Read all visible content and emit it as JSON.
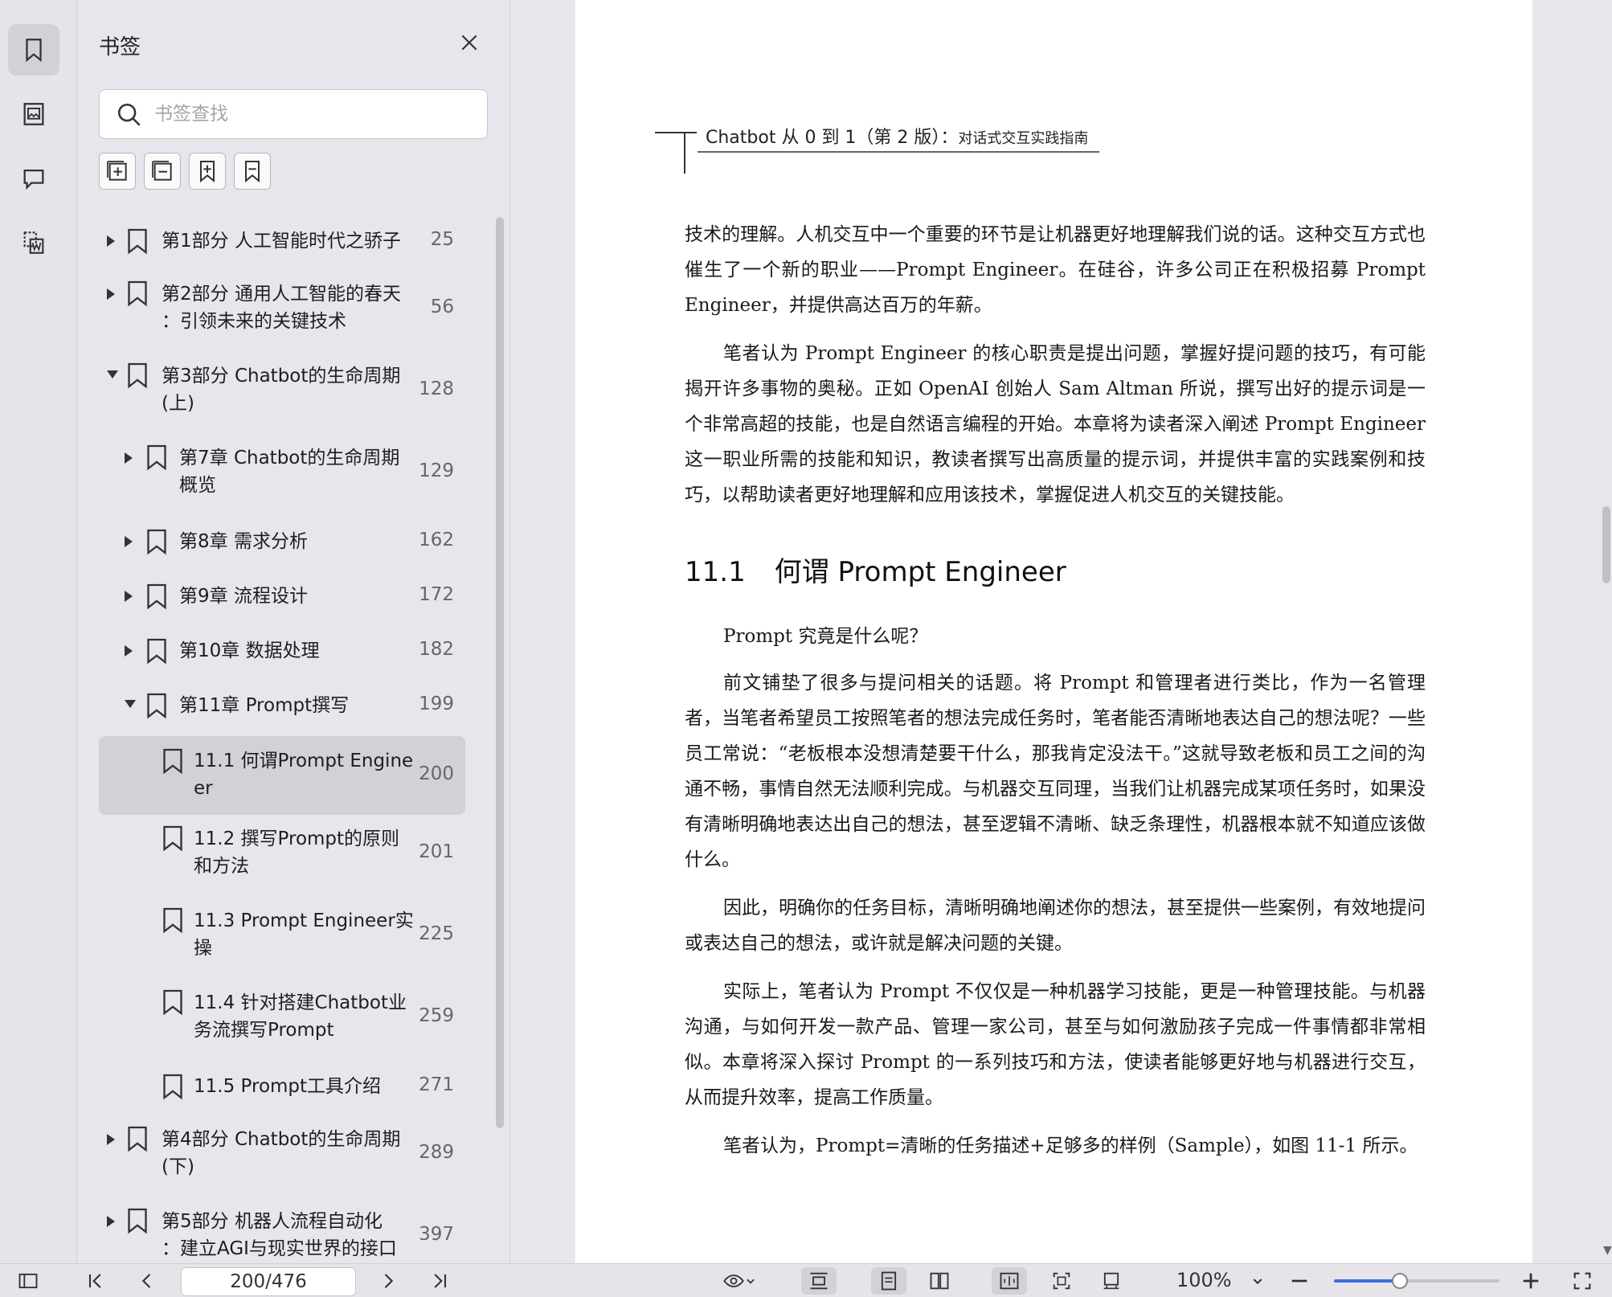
{
  "panel": {
    "title": "书签",
    "search_placeholder": "书签查找"
  },
  "tree": [
    {
      "label": "第1部分 人工智能时代之骄子",
      "page": "25",
      "level": 0,
      "expanded": false
    },
    {
      "label": "第2部分 通用人工智能的春天\n：引领未来的关键技术",
      "page": "56",
      "level": 0,
      "expanded": false
    },
    {
      "label": "第3部分 Chatbot的生命周期\n(上)",
      "page": "128",
      "level": 0,
      "expanded": true
    },
    {
      "label": "第7章 Chatbot的生命周期\n概览",
      "page": "129",
      "level": 1,
      "expanded": false
    },
    {
      "label": "第8章 需求分析",
      "page": "162",
      "level": 1,
      "expanded": false
    },
    {
      "label": "第9章 流程设计",
      "page": "172",
      "level": 1,
      "expanded": false
    },
    {
      "label": "第10章 数据处理",
      "page": "182",
      "level": 1,
      "expanded": false
    },
    {
      "label": "第11章 Prompt撰写",
      "page": "199",
      "level": 1,
      "expanded": true
    },
    {
      "label": "11.1 何谓Prompt Engine\ner",
      "page": "200",
      "level": 2,
      "selected": true
    },
    {
      "label": "11.2 撰写Prompt的原则\n和方法",
      "page": "201",
      "level": 2
    },
    {
      "label": "11.3 Prompt Engineer实\n操",
      "page": "225",
      "level": 2
    },
    {
      "label": "11.4 针对搭建Chatbot业\n务流撰写Prompt",
      "page": "259",
      "level": 2
    },
    {
      "label": "11.5 Prompt工具介绍",
      "page": "271",
      "level": 2
    },
    {
      "label": "第4部分 Chatbot的生命周期\n(下)",
      "page": "289",
      "level": 0,
      "expanded": false
    },
    {
      "label": "第5部分 机器人流程自动化\n：建立AGI与现实世界的接口",
      "page": "397",
      "level": 0,
      "expanded": false
    }
  ],
  "document": {
    "running_head_main": "Chatbot 从 0 到 1（第 2 版）：",
    "running_head_sub": "对话式交互实践指南",
    "p1": "技术的理解。人机交互中一个重要的环节是让机器更好地理解我们说的话。这种交互方式也催生了一个新的职业——Prompt Engineer。在硅谷，许多公司正在积极招募 Prompt Engineer，并提供高达百万的年薪。",
    "p2": "笔者认为 Prompt Engineer 的核心职责是提出问题，掌握好提问题的技巧，有可能揭开许多事物的奥秘。正如 OpenAI 创始人 Sam Altman 所说，撰写出好的提示词是一个非常高超的技能，也是自然语言编程的开始。本章将为读者深入阐述 Prompt Engineer 这一职业所需的技能和知识，教读者撰写出高质量的提示词，并提供丰富的实践案例和技巧，以帮助读者更好地理解和应用该技术，掌握促进人机交互的关键技能。",
    "section_num": "11.1",
    "section_title": "何谓 Prompt Engineer",
    "p3": "Prompt 究竟是什么呢？",
    "p4": "前文铺垫了很多与提问相关的话题。将 Prompt 和管理者进行类比，作为一名管理者，当笔者希望员工按照笔者的想法完成任务时，笔者能否清晰地表达自己的想法呢？一些员工常说：“老板根本没想清楚要干什么，那我肯定没法干。”这就导致老板和员工之间的沟通不畅，事情自然无法顺利完成。与机器交互同理，当我们让机器完成某项任务时，如果没有清晰明确地表达出自己的想法，甚至逻辑不清晰、缺乏条理性，机器根本就不知道应该做什么。",
    "p5": "因此，明确你的任务目标，清晰明确地阐述你的想法，甚至提供一些案例，有效地提问或表达自己的想法，或许就是解决问题的关键。",
    "p6": "实际上，笔者认为 Prompt 不仅仅是一种机器学习技能，更是一种管理技能。与机器沟通，与如何开发一款产品、管理一家公司，甚至与如何激励孩子完成一件事情都非常相似。本章将深入探讨 Prompt 的一系列技巧和方法，使读者能够更好地与机器进行交互，从而提升效率，提高工作质量。",
    "p7": "笔者认为，Prompt=清晰的任务描述+足够多的样例（Sample），如图 11-1 所示。"
  },
  "bottom_bar": {
    "page_value": "200/476",
    "zoom": "100%",
    "zoom_fraction": 0.4
  },
  "colors": {
    "accent": "#3b6fe0",
    "selected": "#d3d1d7"
  }
}
